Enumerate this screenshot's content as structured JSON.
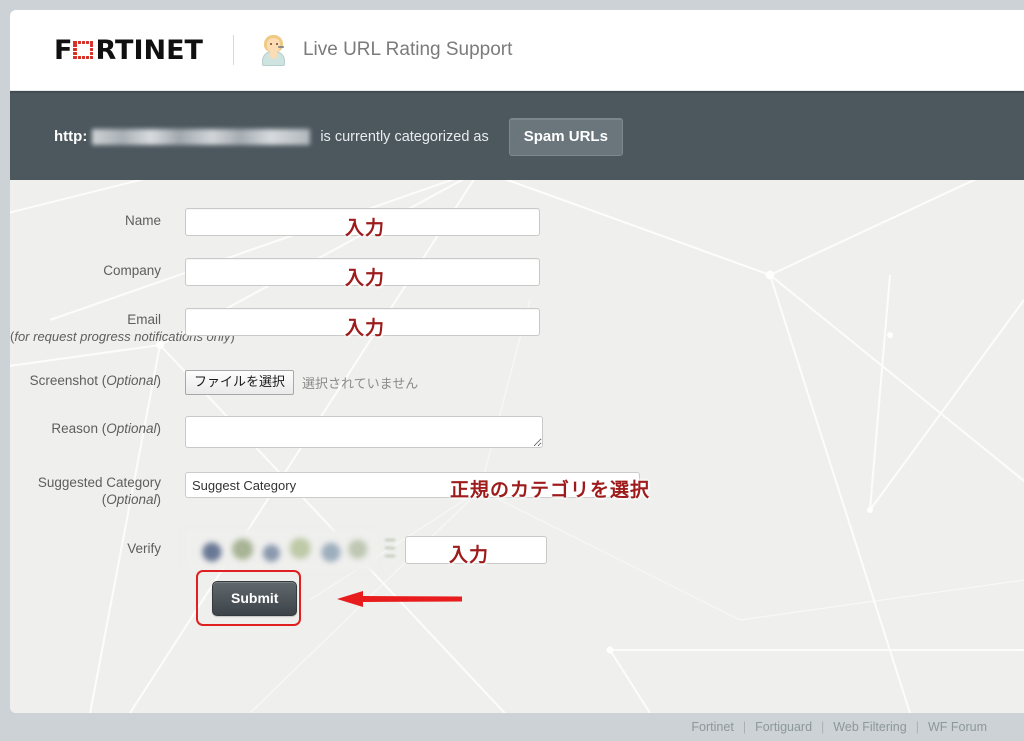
{
  "header": {
    "logo_text_before": "F",
    "logo_text_after": "RTINET",
    "agent_icon": "support-agent-icon",
    "title": "Live URL Rating Support"
  },
  "status": {
    "protocol": "http:",
    "url_redacted": "",
    "message": "is currently categorized as",
    "category_button": "Spam URLs"
  },
  "form": {
    "rows": {
      "name": {
        "label": "Name",
        "value": "",
        "annotation": "入力"
      },
      "company": {
        "label": "Company",
        "value": "",
        "annotation": "入力"
      },
      "email": {
        "label": "Email",
        "label_note": "(for request progress notifications only)",
        "label_note_italic": "for request progress notifications only",
        "value": "",
        "annotation": "入力"
      },
      "screenshot": {
        "label": "Screenshot (",
        "label_optional": "Optional",
        "label_close": ")",
        "file_button": "ファイルを選択",
        "file_status": "選択されていません"
      },
      "reason": {
        "label": "Reason (",
        "label_optional": "Optional",
        "label_close": ")",
        "value": ""
      },
      "suggested_category": {
        "label": "Suggested Category",
        "label_optional": "Optional",
        "selected": "Suggest Category",
        "annotation": "正規のカテゴリを選択"
      },
      "verify": {
        "label": "Verify",
        "captcha_alt": "captcha-image",
        "value": "",
        "annotation": "入力"
      }
    },
    "submit_label": "Submit"
  },
  "footer": {
    "links": [
      "Fortinet",
      "Fortiguard",
      "Web Filtering",
      "WF Forum"
    ],
    "separator": "|"
  },
  "colors": {
    "band": "#4c575e",
    "page_bg": "#ccd2d6",
    "form_bg": "#efefed",
    "accent_red": "#9e1b1b",
    "highlight_red": "#e02020",
    "logo_red": "#d63127"
  }
}
